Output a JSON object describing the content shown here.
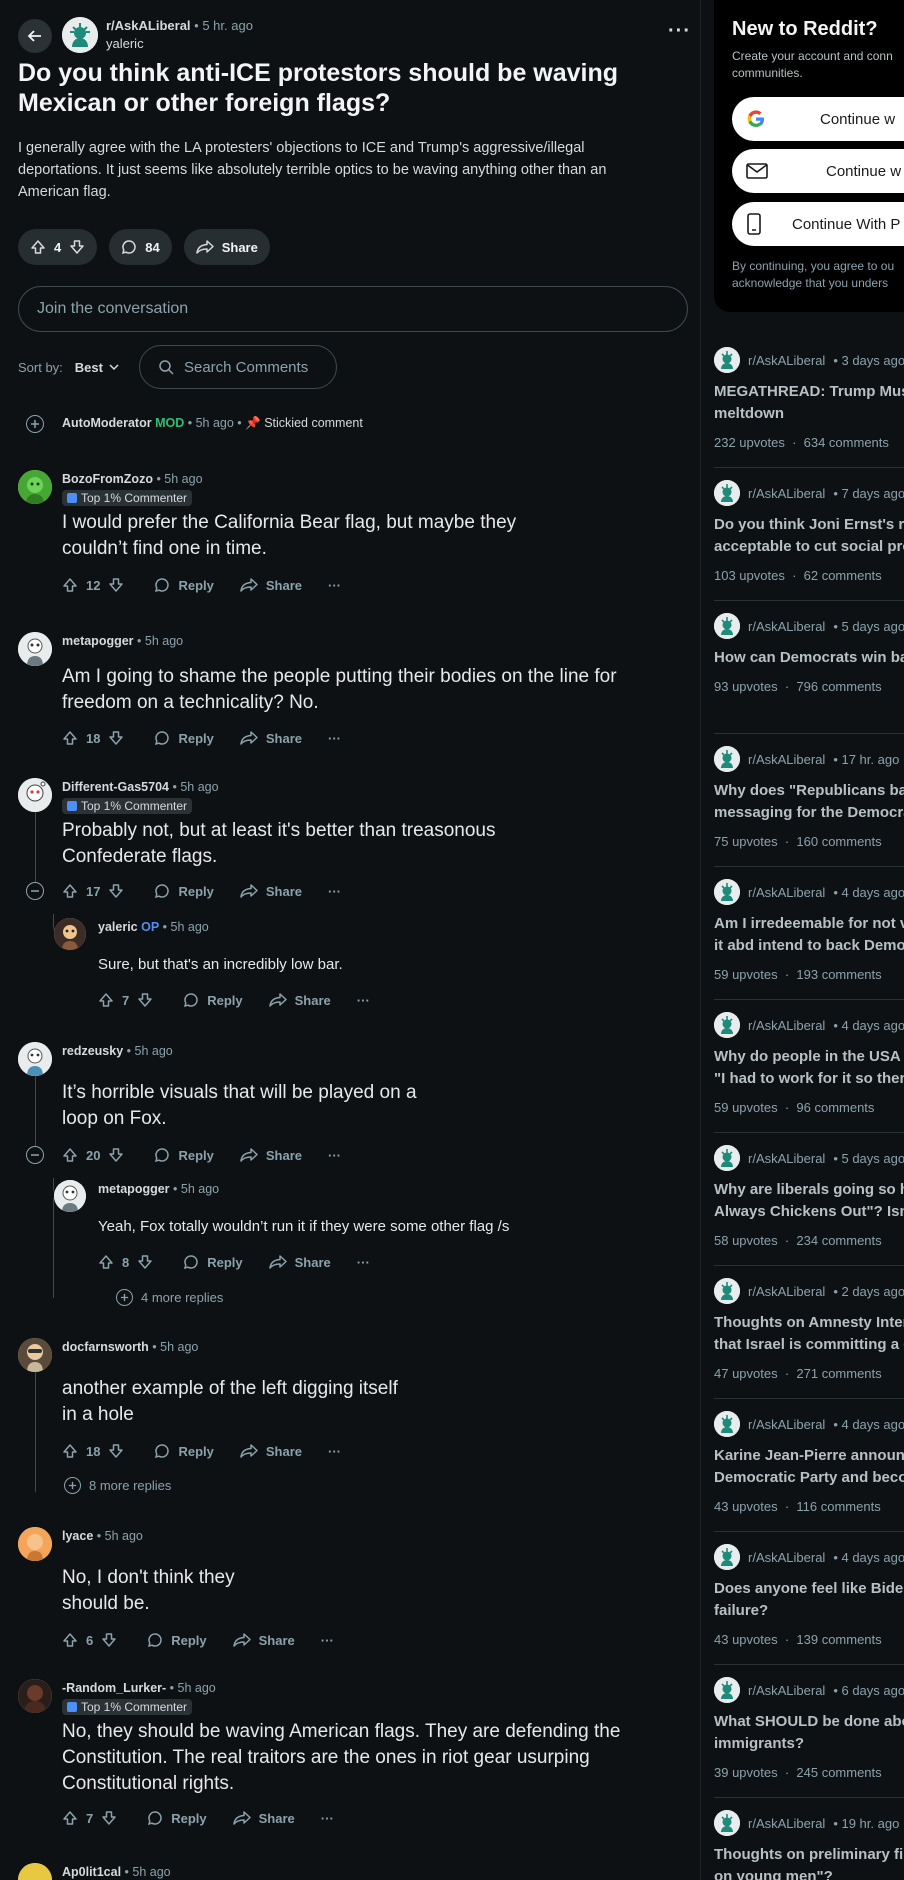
{
  "post": {
    "subreddit": "r/AskALiberal",
    "time": "• 5 hr. ago",
    "author": "yaleric",
    "more": "···",
    "title": "Do you think anti-ICE protestors should be waving Mexican or other foreign flags?",
    "body": "I generally agree with the LA protesters' objections to ICE and Trump's aggressive/illegal deportations. It just seems like absolutely terrible optics to be waving anything other than an American flag.",
    "votes": "4",
    "comments": "84",
    "share_label": "Share"
  },
  "join_placeholder": "Join the conversation",
  "sort": {
    "label": "Sort by:",
    "value": "Best",
    "search_placeholder": "Search Comments"
  },
  "automod": {
    "user": "AutoModerator",
    "tag": "MOD",
    "time": "• 5h ago •",
    "sticky": "Stickied comment"
  },
  "labels": {
    "reply": "Reply",
    "share": "Share",
    "dots": "···",
    "top_commenter": "Top 1% Commenter"
  },
  "comments": [
    {
      "user": "BozoFromZozo",
      "time": "• 5h ago",
      "text": "I would prefer the California Bear flag, but maybe they couldn’t find one in time.",
      "votes": "12"
    },
    {
      "user": "metapogger",
      "time": "• 5h ago",
      "text": "Am I going to shame the people putting their bodies on the line for freedom on a technicality? No.",
      "votes": "18"
    },
    {
      "user": "Different-Gas5704",
      "time": "• 5h ago",
      "text": "Probably not, but at least it's better than treasonous Confederate flags.",
      "votes": "17"
    },
    {
      "user": "yaleric",
      "tag": "OP",
      "time": "• 5h ago",
      "text": "Sure, but that's an incredibly low bar.",
      "votes": "7"
    },
    {
      "user": "redzeusky",
      "time": "• 5h ago",
      "text": "It’s horrible visuals that will be played on a loop on Fox.",
      "votes": "20"
    },
    {
      "user": "metapogger",
      "time": "• 5h ago",
      "text": "Yeah, Fox totally wouldn’t run it if they were some other flag /s",
      "votes": "8",
      "more": "4 more replies"
    },
    {
      "user": "docfarnsworth",
      "time": "• 5h ago",
      "text": "another example of the left digging itself in a hole",
      "votes": "18",
      "more": "8 more replies"
    },
    {
      "user": "lyace",
      "time": "• 5h ago",
      "text": "No, I don't think they should be.",
      "votes": "6"
    },
    {
      "user": "-Random_Lurker-",
      "time": "• 5h ago",
      "text": "No, they should be waving American flags. They are defending the Constitution. The real traitors are the ones in riot gear usurping Constitutional rights.",
      "votes": "7"
    },
    {
      "user": "Ap0lit1cal",
      "time": "• 5h ago"
    }
  ],
  "signup": {
    "title": "New to Reddit?",
    "subtitle_1": "Create your account and conn",
    "subtitle_2": "communities.",
    "google": "Continue w",
    "email": "Continue w",
    "phone": "Continue With P",
    "terms_1": "By continuing, you agree to ou",
    "terms_2": "acknowledge that you unders"
  },
  "related": [
    {
      "sub": "r/AskALiberal",
      "time": "• 3 days ago",
      "title_1": "MEGATHREAD: Trump Mus",
      "title_2": "meltdown",
      "upvotes": "232 upvotes",
      "comments": "634 comments"
    },
    {
      "sub": "r/AskALiberal",
      "time": "• 7 days ago",
      "title_1": "Do you think Joni Ernst's re",
      "title_2": "acceptable to cut social pro",
      "upvotes": "103 upvotes",
      "comments": "62 comments"
    },
    {
      "sub": "r/AskALiberal",
      "time": "• 5 days ago",
      "title_1": "How can Democrats win bac",
      "title_2": "",
      "upvotes": "93 upvotes",
      "comments": "796 comments"
    },
    {
      "sub": "r/AskALiberal",
      "time": "• 17 hr. ago",
      "title_1": "Why does \"Republicans bad",
      "title_2": "messaging for the Democra",
      "upvotes": "75 upvotes",
      "comments": "160 comments"
    },
    {
      "sub": "r/AskALiberal",
      "time": "• 4 days ago",
      "title_1": "Am I irredeemable for not v",
      "title_2": "it abd intend to back Demo",
      "upvotes": "59 upvotes",
      "comments": "193 comments"
    },
    {
      "sub": "r/AskALiberal",
      "time": "• 4 days ago",
      "title_1": "Why do people in the USA re",
      "title_2": "\"I had to work for it so then",
      "upvotes": "59 upvotes",
      "comments": "96 comments"
    },
    {
      "sub": "r/AskALiberal",
      "time": "• 5 days ago",
      "title_1": "Why are liberals going so ha",
      "title_2": "Always Chickens Out\"? Isn't",
      "upvotes": "58 upvotes",
      "comments": "234 comments"
    },
    {
      "sub": "r/AskALiberal",
      "time": "• 2 days ago",
      "title_1": "Thoughts on Amnesty Intern",
      "title_2": "that Israel is committing a g",
      "upvotes": "47 upvotes",
      "comments": "271 comments"
    },
    {
      "sub": "r/AskALiberal",
      "time": "• 4 days ago",
      "title_1": "Karine Jean-Pierre announc",
      "title_2": "Democratic Party and becor",
      "upvotes": "43 upvotes",
      "comments": "116 comments"
    },
    {
      "sub": "r/AskALiberal",
      "time": "• 4 days ago",
      "title_1": "Does anyone feel like Biden",
      "title_2": "failure?",
      "upvotes": "43 upvotes",
      "comments": "139 comments"
    },
    {
      "sub": "r/AskALiberal",
      "time": "• 6 days ago",
      "title_1": "What SHOULD be done abou",
      "title_2": "immigrants?",
      "upvotes": "39 upvotes",
      "comments": "245 comments"
    },
    {
      "sub": "r/AskALiberal",
      "time": "• 19 hr. ago",
      "title_1": "Thoughts on preliminary fin",
      "title_2": "on young men\"?",
      "upvotes": "",
      "comments": ""
    }
  ],
  "colors": {
    "background": "#0e1113",
    "mod_green": "#2fbf71",
    "op_blue": "#4e8ef7",
    "pill": "#272e32"
  }
}
